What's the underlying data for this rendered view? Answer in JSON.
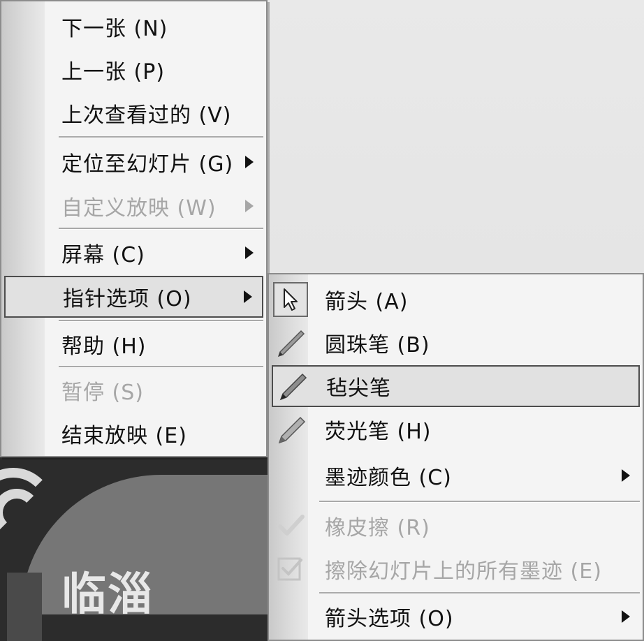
{
  "main_menu": {
    "items": [
      {
        "label": "下一张 (N)",
        "enabled": true,
        "submenu": false
      },
      {
        "label": "上一张 (P)",
        "enabled": true,
        "submenu": false
      },
      {
        "label": "上次查看过的 (V)",
        "enabled": true,
        "submenu": false
      },
      {
        "label": "定位至幻灯片 (G)",
        "enabled": true,
        "submenu": true
      },
      {
        "label": "自定义放映 (W)",
        "enabled": false,
        "submenu": true
      },
      {
        "label": "屏幕 (C)",
        "enabled": true,
        "submenu": true
      },
      {
        "label": "指针选项 (O)",
        "enabled": true,
        "submenu": true,
        "highlighted": true
      },
      {
        "label": "帮助 (H)",
        "enabled": true,
        "submenu": false
      },
      {
        "label": "暂停 (S)",
        "enabled": false,
        "submenu": false
      },
      {
        "label": "结束放映 (E)",
        "enabled": true,
        "submenu": false
      }
    ]
  },
  "pointer_submenu": {
    "items": [
      {
        "label": "箭头 (A)",
        "icon": "arrow-cursor-icon",
        "checked": true
      },
      {
        "label": "圆珠笔 (B)",
        "icon": "ballpoint-pen-icon"
      },
      {
        "label": "毡尖笔",
        "icon": "felt-tip-pen-icon",
        "highlighted": true
      },
      {
        "label": "荧光笔 (H)",
        "icon": "highlighter-pen-icon"
      },
      {
        "label": "墨迹颜色 (C)",
        "submenu": true
      },
      {
        "label": "橡皮擦 (R)",
        "icon": "eraser-icon",
        "enabled": false
      },
      {
        "label": "擦除幻灯片上的所有墨迹 (E)",
        "icon": "erase-all-ink-icon",
        "enabled": false
      },
      {
        "label": "箭头选项 (O)",
        "submenu": true
      }
    ]
  },
  "slide_background": {
    "text": "临淄"
  },
  "colors": {
    "menu_bg": "#f4f4f4",
    "disabled_text": "#a6a6a6",
    "highlight_border": "#4d4d4d"
  }
}
